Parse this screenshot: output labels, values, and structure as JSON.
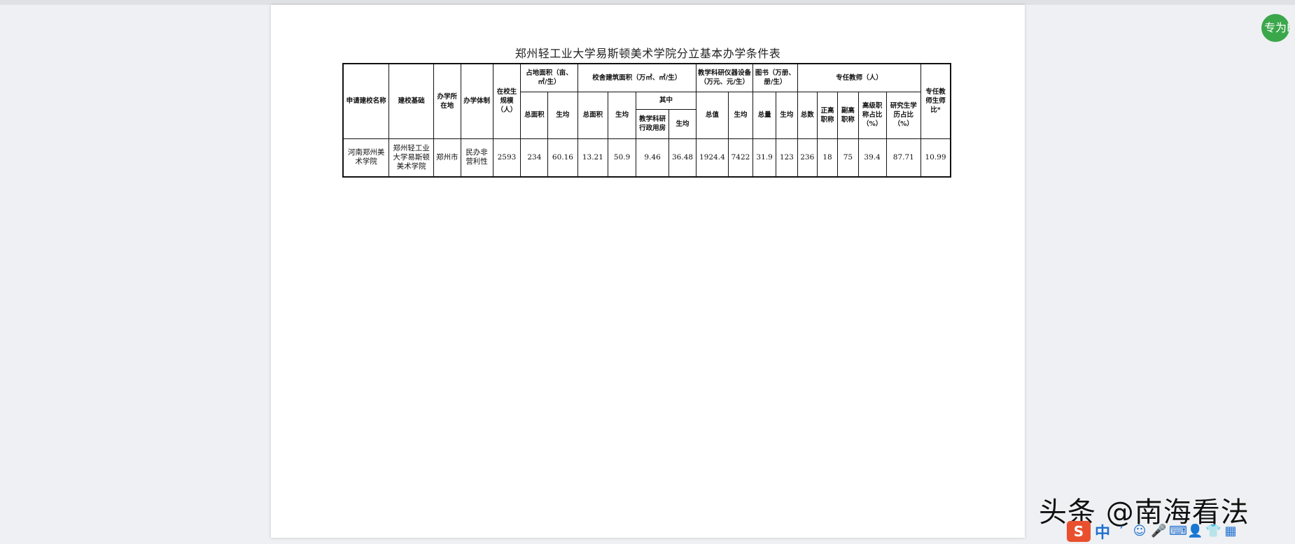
{
  "document": {
    "title": "郑州轻工业大学易斯顿美术学院分立基本办学条件表"
  },
  "table": {
    "headers": {
      "school_name": "申请建校名称",
      "foundation": "建校基础",
      "location": "办学所在地",
      "system": "办学体制",
      "enrollment": "在校生规模（人）",
      "land_group": "占地面积（亩、㎡/生）",
      "land_total": "总面积",
      "land_per": "生均",
      "building_group": "校舍建筑面积（万㎡、㎡/生）",
      "building_total": "总面积",
      "building_per": "生均",
      "building_of_which": "其中",
      "building_teaching": "教学科研行政用房",
      "building_teaching_per": "生均",
      "equip_group": "教学科研仪器设备（万元、元/生）",
      "equip_total": "总值",
      "equip_per": "生均",
      "books_group": "图书（万册、册/生）",
      "books_total": "总量",
      "books_per": "生均",
      "teacher_group": "专任教师（人）",
      "teacher_total": "总数",
      "teacher_full": "正高职称",
      "teacher_associate": "副高职称",
      "teacher_senior_ratio": "高级职称占比（%）",
      "teacher_grad_ratio": "研究生学历占比（%）",
      "teacher_student_ratio": "专任教师生师比*"
    },
    "row": {
      "school_name": "河南郑州美术学院",
      "foundation": "郑州轻工业大学易斯顿美术学院",
      "location": "郑州市",
      "system": "民办非营利性",
      "enrollment": "2593",
      "land_total": "234",
      "land_per": "60.16",
      "building_total": "13.21",
      "building_per": "50.9",
      "building_teaching": "9.46",
      "building_teaching_per": "36.48",
      "equip_total": "1924.4",
      "equip_per": "7422",
      "books_total": "31.9",
      "books_per": "123",
      "teacher_total": "236",
      "teacher_full": "18",
      "teacher_associate": "75",
      "teacher_senior_ratio": "39.4",
      "teacher_grad_ratio": "87.71",
      "teacher_student_ratio": "10.99"
    }
  },
  "badge": {
    "text": "专为E",
    "color": "#3aa74b"
  },
  "watermark": {
    "text": "头条 @南海看法"
  },
  "ime_toolbar": {
    "logo": "S",
    "language": "中",
    "icons": [
      "punctuation-icon",
      "emoji-icon",
      "microphone-icon",
      "keyboard-icon",
      "user-icon",
      "shirt-icon",
      "grid-icon"
    ]
  }
}
